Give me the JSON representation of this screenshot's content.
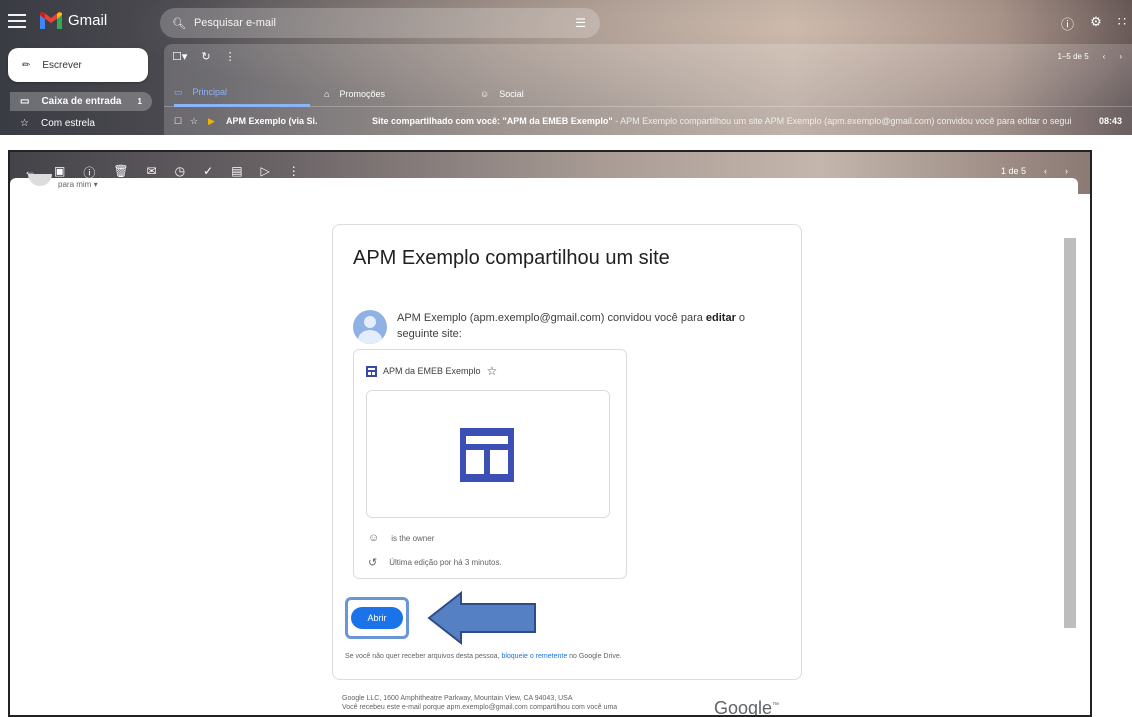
{
  "top": {
    "app_name": "Gmail",
    "search_placeholder": "Pesquisar e-mail",
    "compose_label": "Escrever",
    "nav": [
      {
        "label": "Caixa de entrada",
        "count": "1"
      },
      {
        "label": "Com estrela"
      }
    ],
    "pager": "1–5 de 5",
    "tabs": [
      {
        "label": "Principal"
      },
      {
        "label": "Promoções"
      },
      {
        "label": "Social"
      }
    ],
    "email": {
      "sender": "APM Exemplo (via Si.",
      "subject": "Site compartilhado com você: \"APM da EMEB Exemplo\"",
      "snippet": " - APM Exemplo compartilhou um site APM Exemplo (apm.exemplo@gmail.com) convidou você para editar o seguinte site: A...",
      "time": "08:43"
    }
  },
  "message": {
    "pager": "1 de 5",
    "to_line": "para mim",
    "title": "APM Exemplo compartilhou um site",
    "invite_pre": "APM Exemplo (apm.exemplo@gmail.com) convidou você para ",
    "invite_bold": "editar",
    "invite_post": " o seguinte site:",
    "site_name": "APM da EMEB Exemplo",
    "owner_line": "is the owner",
    "edited_line": "Última edição por há 3 minutos.",
    "open_button": "Abrir",
    "unsub_pre": "Se você não quer receber arquivos desta pessoa, ",
    "unsub_link": "bloqueie o remetente",
    "unsub_post": " no Google Drive.",
    "footer_line1": "Google LLC, 1600 Amphitheatre Parkway, Mountain View, CA 94043, USA",
    "footer_line2": "Você recebeu este e-mail porque apm.exemplo@gmail.com compartilhou com você uma",
    "google_logo": "Google"
  },
  "colors": {
    "accent": "#1a73e8",
    "site_icon": "#3c4fb4",
    "highlight": "#6a96d9"
  }
}
